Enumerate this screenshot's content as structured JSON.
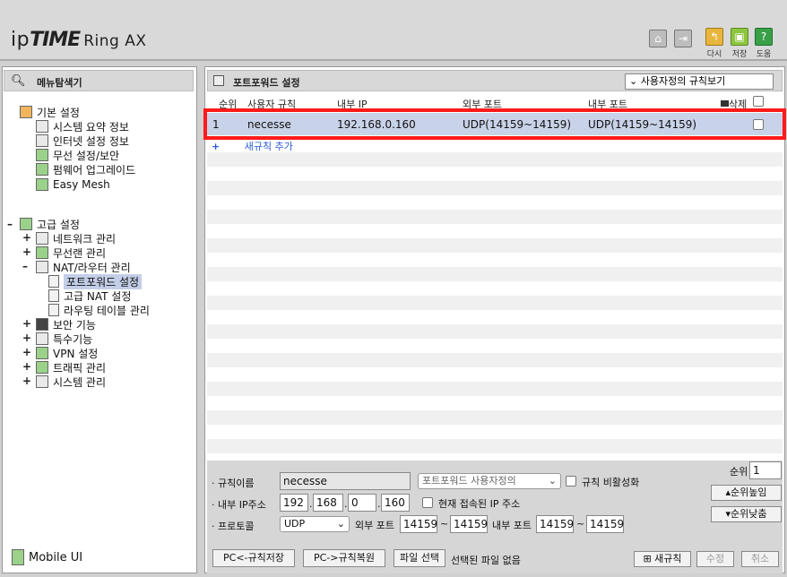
{
  "header": {
    "logo_ip": "ip",
    "logo_time": "TIME",
    "logo_model": "Ring AX",
    "actions": [
      {
        "icon": "home-icon",
        "label": ""
      },
      {
        "icon": "logout-icon",
        "label": ""
      },
      {
        "icon": "undo-icon",
        "label": "다시"
      },
      {
        "icon": "save-icon",
        "label": "저장"
      },
      {
        "icon": "help-icon",
        "label": "도움"
      }
    ]
  },
  "sidebar": {
    "title": "메뉴탐색기",
    "basic": {
      "label": "기본 설정",
      "items": [
        "시스템 요약 정보",
        "인터넷 설정 정보",
        "무선 설정/보안",
        "펌웨어 업그레이드",
        "Easy Mesh"
      ]
    },
    "advanced": {
      "label": "고급 설정",
      "items": [
        "네트워크 관리",
        "무선랜 관리",
        "NAT/라우터 관리"
      ],
      "nat_children": [
        "포트포워드 설정",
        "고급 NAT 설정",
        "라우팅 테이블 관리"
      ],
      "more_items": [
        "보안 기능",
        "특수기능",
        "VPN 설정",
        "트래픽 관리",
        "시스템 관리"
      ]
    },
    "mobile_ui": "Mobile UI"
  },
  "main": {
    "title": "포트포워드 설정",
    "view_select": "사용자정의 규칙보기",
    "columns": {
      "order": "순위",
      "rule": "사용자 규칙",
      "internal_ip": "내부 IP",
      "external_port": "외부 포트",
      "internal_port": "내부 포트",
      "delete": "삭제"
    },
    "rules": [
      {
        "order": "1",
        "name": "necesse",
        "ip": "192.168.0.160",
        "ext_port": "UDP(14159~14159)",
        "int_port": "UDP(14159~14159)"
      }
    ],
    "add_rule": "새규칙 추가"
  },
  "form": {
    "rule_name_label": "규칙이름",
    "rule_name_value": "necesse",
    "preset_select": "포트포워드 사용자정의",
    "disable_rule_label": "규칙 비활성화",
    "ip_label": "내부 IP주소",
    "ip": [
      "192",
      "168",
      "0",
      "160"
    ],
    "current_ip_label": "현재 접속된 IP 주소",
    "protocol_label": "프로토콜",
    "protocol_value": "UDP",
    "ext_port_label": "외부 포트",
    "ext_port_from": "14159",
    "ext_port_to": "14159",
    "int_port_label": "내부 포트",
    "int_port_from": "14159",
    "int_port_to": "14159",
    "tilde": "~",
    "order_label": "순위",
    "order_value": "1",
    "order_up": "순위높임",
    "order_down": "순위낮춤",
    "btn_pc_save": "PC<-규칙저장",
    "btn_pc_restore": "PC->규칙복원",
    "btn_file_select": "파일 선택",
    "file_status": "선택된 파일 없음",
    "btn_new_rule": "새규칙",
    "btn_modify": "수정",
    "btn_cancel": "취소"
  }
}
